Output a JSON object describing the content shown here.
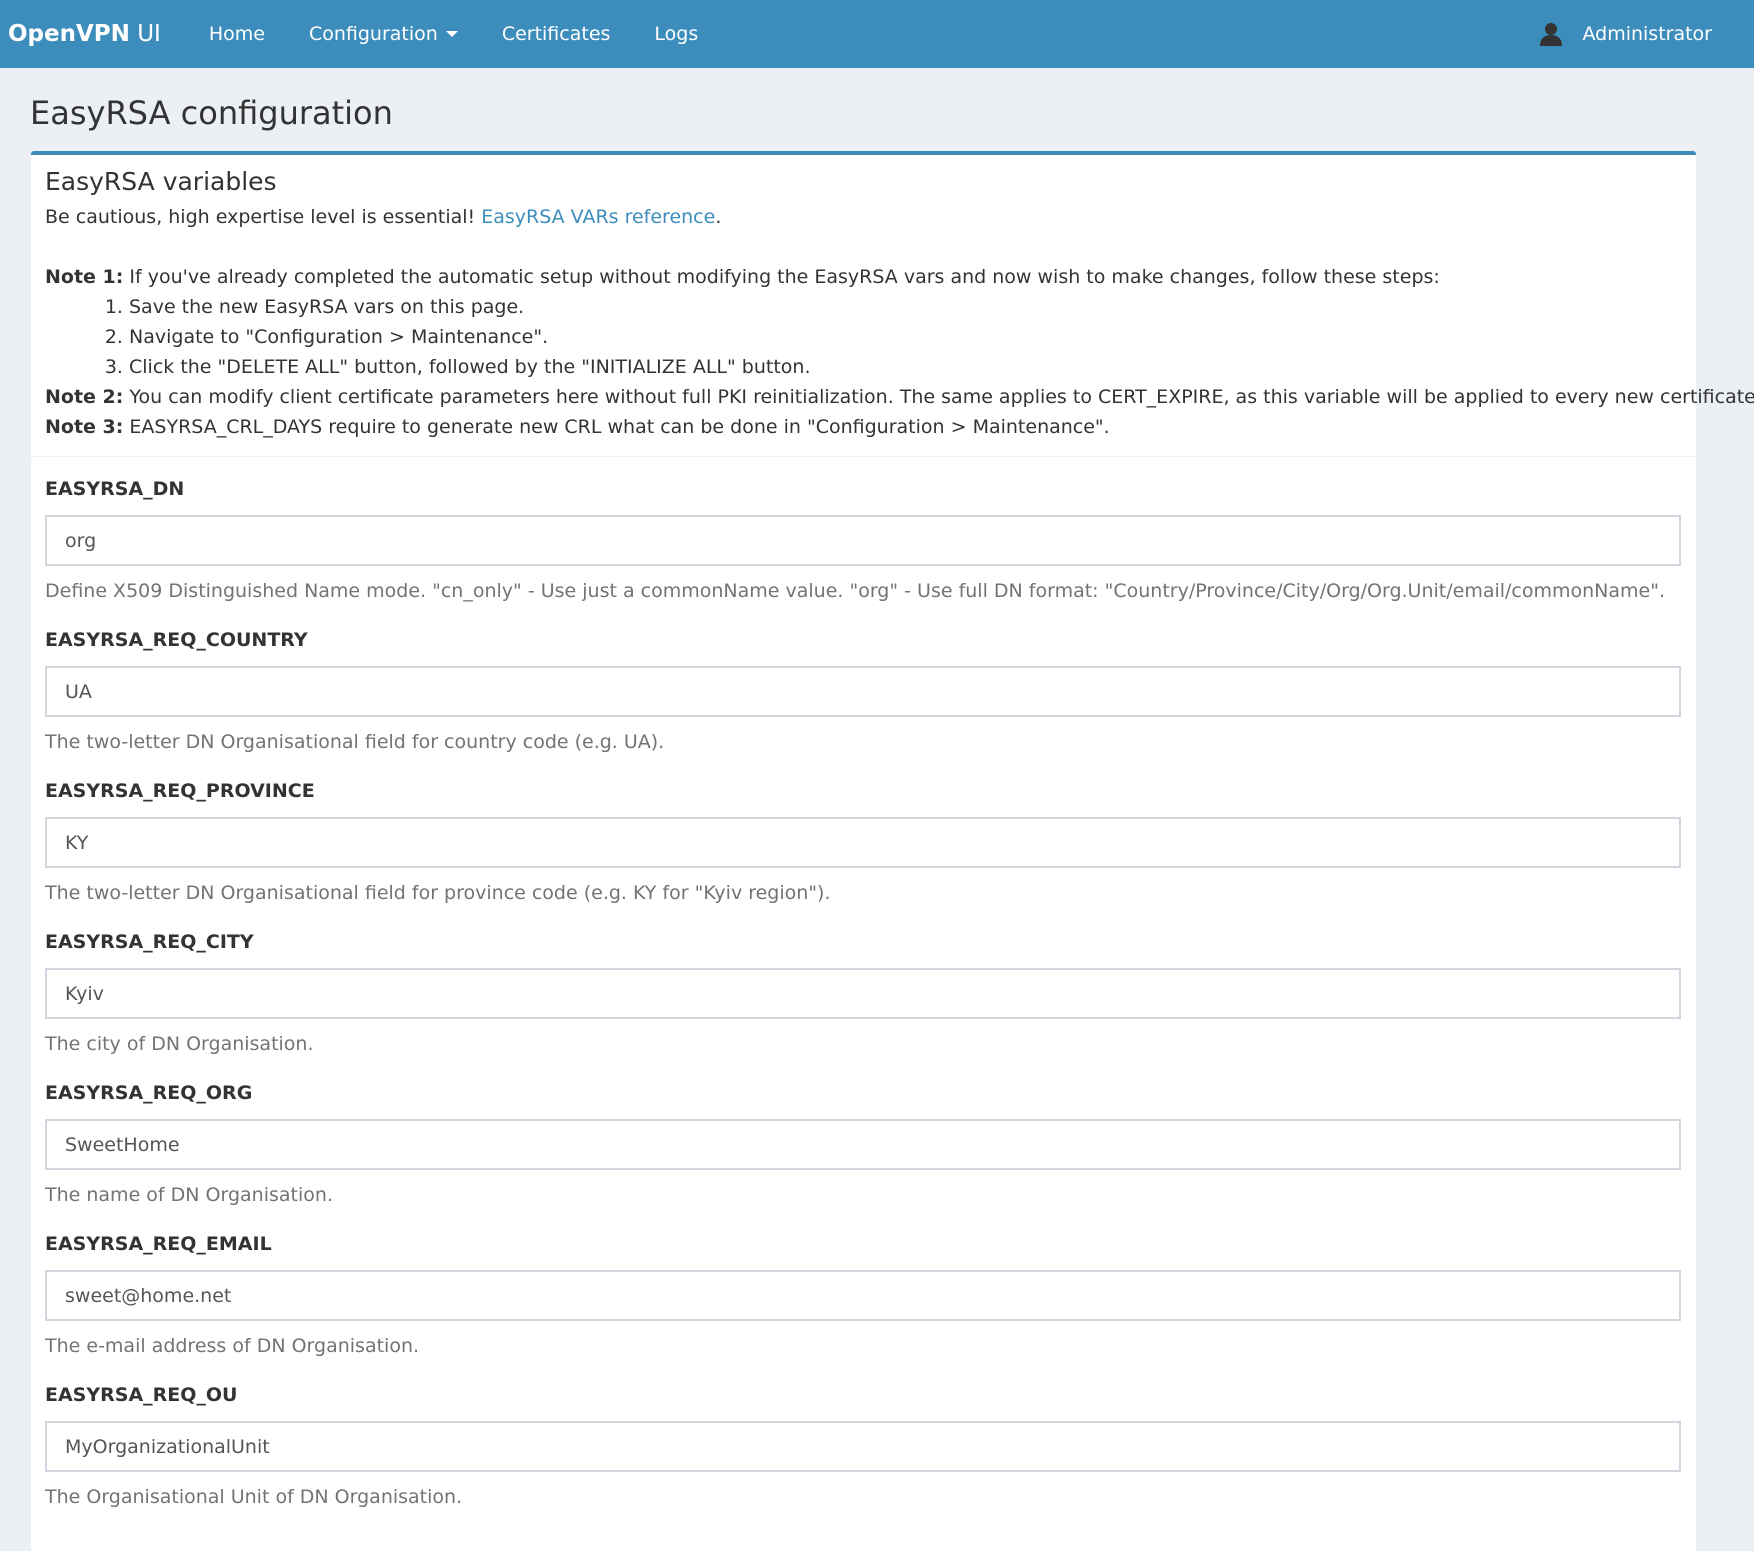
{
  "navbar": {
    "brand_bold": "OpenVPN",
    "brand_light": "UI",
    "items": [
      {
        "label": "Home"
      },
      {
        "label": "Configuration"
      },
      {
        "label": "Certificates"
      },
      {
        "label": "Logs"
      }
    ],
    "user": "Administrator"
  },
  "page": {
    "title": "EasyRSA configuration"
  },
  "box": {
    "title": "EasyRSA variables",
    "caution": "Be cautious, high expertise level is essential!",
    "reference_link": "EasyRSA VARs reference",
    "period": ".",
    "note1_label": "Note 1:",
    "note1_text": "If you've already completed the automatic setup without modifying the EasyRSA vars and now wish to make changes, follow these steps:",
    "steps": [
      "Save the new EasyRSA vars on this page.",
      "Navigate to \"Configuration > Maintenance\".",
      "Click the \"DELETE ALL\" button, followed by the \"INITIALIZE ALL\" button."
    ],
    "note2_label": "Note 2:",
    "note2_text": "You can modify client certificate parameters here without full PKI reinitialization. The same applies to CERT_EXPIRE, as this variable will be applied to every new certificate.",
    "note3_label": "Note 3:",
    "note3_text": "EASYRSA_CRL_DAYS require to generate new CRL what can be done in \"Configuration > Maintenance\"."
  },
  "fields": [
    {
      "label": "EASYRSA_DN",
      "value": "org",
      "help": "Define X509 Distinguished Name mode. \"cn_only\" - Use just a commonName value. \"org\" - Use full DN format: \"Country/Province/City/Org/Org.Unit/email/commonName\"."
    },
    {
      "label": "EASYRSA_REQ_COUNTRY",
      "value": "UA",
      "help": "The two-letter DN Organisational field for country code (e.g. UA)."
    },
    {
      "label": "EASYRSA_REQ_PROVINCE",
      "value": "KY",
      "help": "The two-letter DN Organisational field for province code (e.g. KY for \"Kyiv region\")."
    },
    {
      "label": "EASYRSA_REQ_CITY",
      "value": "Kyiv",
      "help": "The city of DN Organisation."
    },
    {
      "label": "EASYRSA_REQ_ORG",
      "value": "SweetHome",
      "help": "The name of DN Organisation."
    },
    {
      "label": "EASYRSA_REQ_EMAIL",
      "value": "sweet@home.net",
      "help": "The e-mail address of DN Organisation."
    },
    {
      "label": "EASYRSA_REQ_OU",
      "value": "MyOrganizationalUnit",
      "help": "The Organisational Unit of DN Organisation."
    }
  ],
  "colors": {
    "primary": "#3c8dbc",
    "background": "#ecf0f5",
    "help_text": "#737373"
  },
  "icons": {
    "user": "user-icon",
    "dropdown": "caret-down-icon"
  }
}
